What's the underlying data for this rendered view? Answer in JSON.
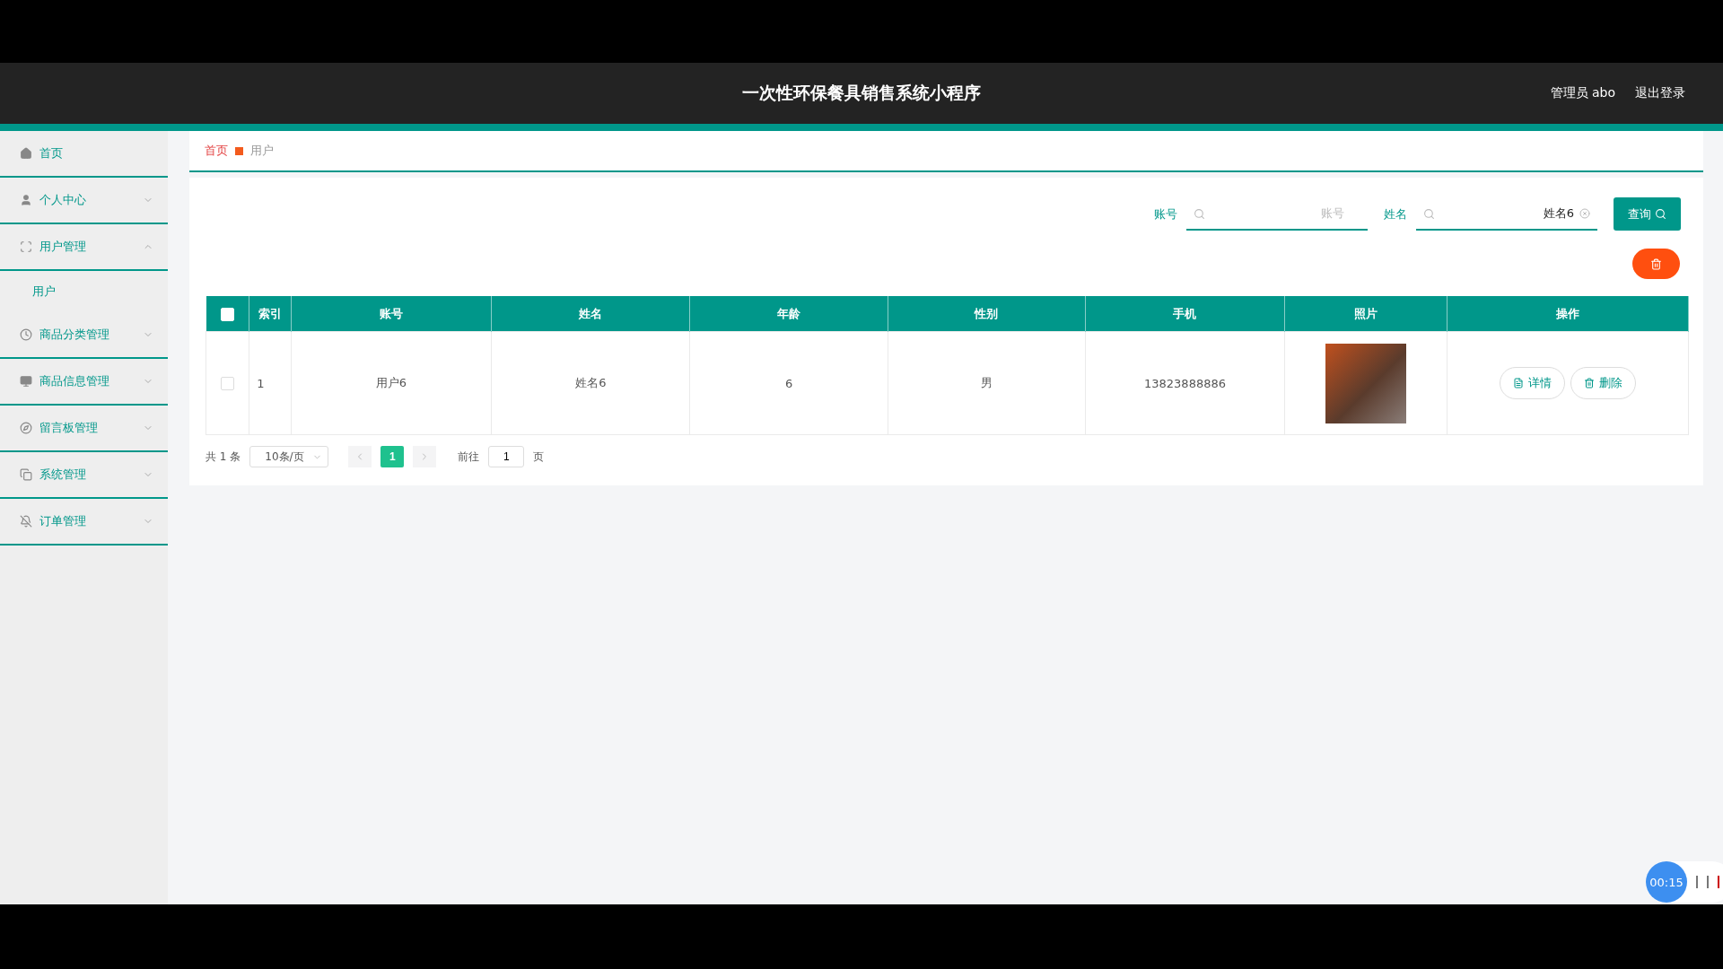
{
  "header": {
    "title": "一次性环保餐具销售系统小程序",
    "user": "管理员 abo",
    "logout": "退出登录"
  },
  "sidebar": {
    "items": [
      {
        "label": "首页",
        "kind": "link"
      },
      {
        "label": "个人中心",
        "kind": "group",
        "expanded": false
      },
      {
        "label": "用户管理",
        "kind": "group",
        "expanded": true,
        "children": [
          {
            "label": "用户",
            "selected": true
          }
        ]
      },
      {
        "label": "商品分类管理",
        "kind": "group",
        "expanded": false
      },
      {
        "label": "商品信息管理",
        "kind": "group",
        "expanded": false
      },
      {
        "label": "留言板管理",
        "kind": "group",
        "expanded": false
      },
      {
        "label": "系统管理",
        "kind": "group",
        "expanded": false
      },
      {
        "label": "订单管理",
        "kind": "group",
        "expanded": false
      }
    ]
  },
  "breadcrumb": [
    "首页",
    "用户"
  ],
  "search": {
    "fields": [
      {
        "label": "账号",
        "placeholder": "账号"
      },
      {
        "label": "姓名",
        "value": "姓名6"
      }
    ],
    "button": "查询"
  },
  "table": {
    "header_checked": false,
    "columns": [
      "索引",
      "账号",
      "姓名",
      "年龄",
      "性别",
      "手机",
      "照片",
      "操作"
    ],
    "rows": [
      {
        "checked": false,
        "cells": [
          "1",
          "用户6",
          "姓名6",
          "6",
          "男",
          "13823888886"
        ],
        "actions": [
          "详情",
          "删除"
        ]
      }
    ]
  },
  "pagination": {
    "total": "共 1 条",
    "page_size": "10条/页",
    "pages": [
      {
        "label": "1",
        "selected": true
      }
    ],
    "goto_label": "前往",
    "goto_value": "1",
    "goto_suffix": "页"
  },
  "recorder": {
    "time": "00:15"
  }
}
